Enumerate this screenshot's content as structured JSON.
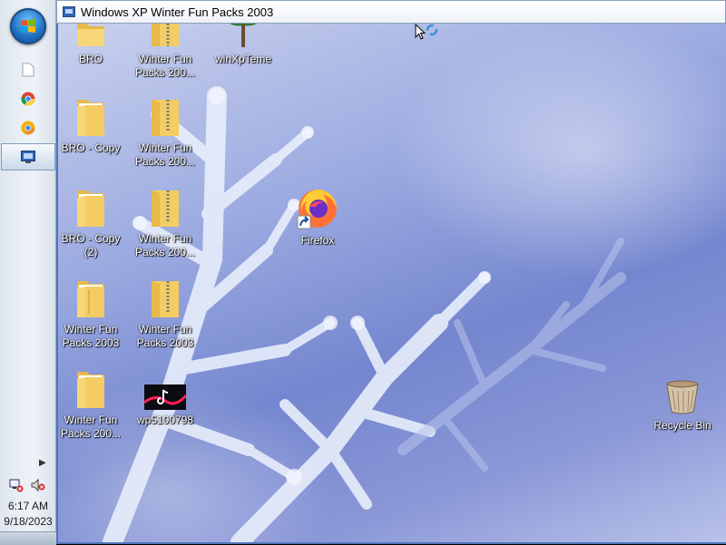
{
  "window": {
    "title": "Windows XP Winter Fun Packs 2003"
  },
  "taskbar": {
    "clock_time": "6:17 AM",
    "clock_date": "9/18/2023",
    "buttons": [
      {
        "icon": "document-icon"
      },
      {
        "icon": "chrome-icon"
      },
      {
        "icon": "chrome-canary-icon"
      },
      {
        "icon": "window-app-icon",
        "active": true
      }
    ],
    "tray": [
      {
        "icon": "network-icon"
      },
      {
        "icon": "muted-speaker-icon"
      }
    ]
  },
  "desktop": {
    "icons": [
      {
        "name": "BRO",
        "kind": "folder"
      },
      {
        "name": "Winter Fun Packs 200...",
        "kind": "zip-folder"
      },
      {
        "name": "winXpTeme",
        "kind": "tree"
      },
      {
        "name": "BRO - Copy",
        "kind": "folder"
      },
      {
        "name": "Winter Fun Packs 200...",
        "kind": "zip-folder"
      },
      {
        "name": "Firefox",
        "kind": "firefox-shortcut"
      },
      {
        "name": "BRO - Copy (2)",
        "kind": "folder"
      },
      {
        "name": "Winter Fun Packs 200...",
        "kind": "zip-folder"
      },
      {
        "name": "Winter Fun Packs 2003",
        "kind": "folder"
      },
      {
        "name": "Winter Fun Packs 2003",
        "kind": "zip-folder"
      },
      {
        "name": "Winter Fun Packs 200...",
        "kind": "folder"
      },
      {
        "name": "wp5100798",
        "kind": "image-thumbnail"
      },
      {
        "name": "Recycle Bin",
        "kind": "recycle-bin"
      }
    ]
  }
}
